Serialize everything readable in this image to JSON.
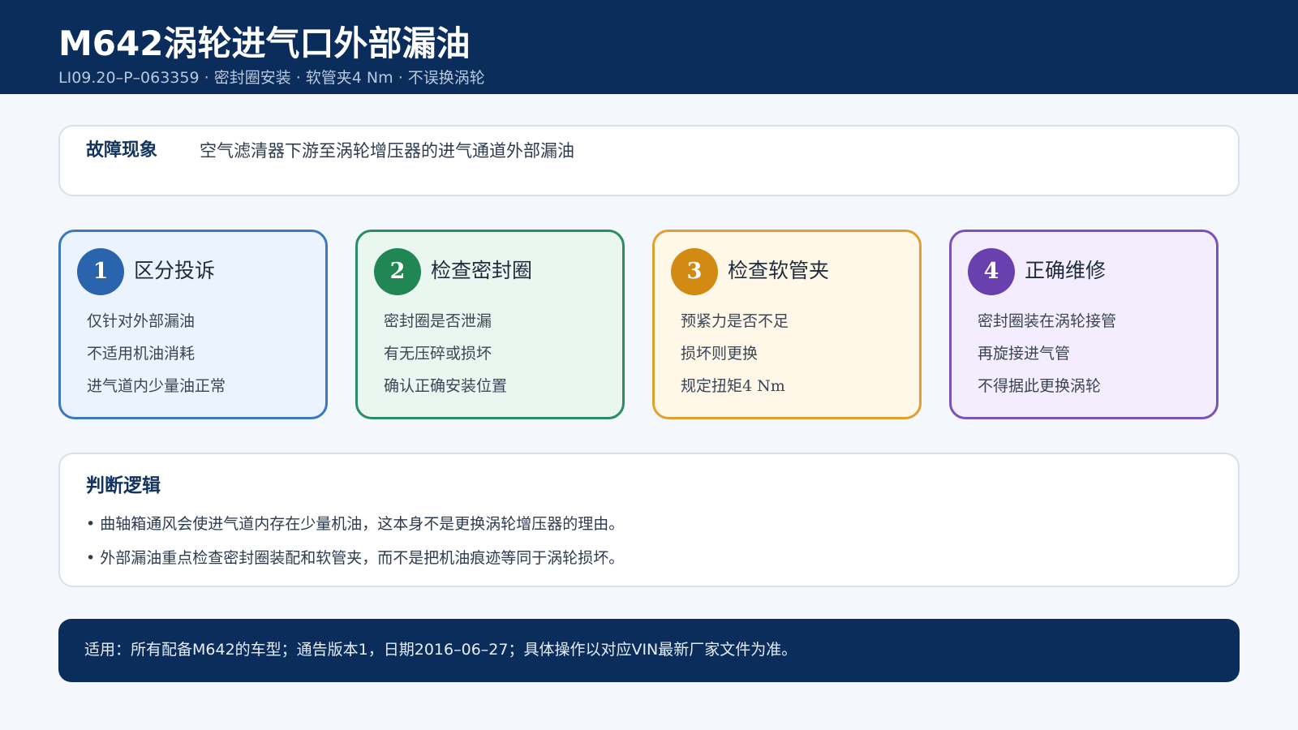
{
  "header": {
    "title": "M642涡轮进气口外部漏油",
    "subtitle": "LI09.20–P–063359 · 密封圈安装 · 软管夹4 Nm · 不误换涡轮"
  },
  "symptom": {
    "label": "故障现象",
    "text": "空气滤清器下游至涡轮增压器的进气通道外部漏油"
  },
  "steps": [
    {
      "number": "1",
      "title": "区分投诉",
      "lines": [
        "仅针对外部漏油",
        "不适用机油消耗",
        "进气道内少量油正常"
      ],
      "color": "#2a64ad"
    },
    {
      "number": "2",
      "title": "检查密封圈",
      "lines": [
        "密封圈是否泄漏",
        "有无压碎或损坏",
        "确认正确安装位置"
      ],
      "color": "#1f8654"
    },
    {
      "number": "3",
      "title": "检查软管夹",
      "lines": [
        "预紧力是否不足",
        "损坏则更换",
        "规定扭矩4 Nm"
      ],
      "color": "#d28a13"
    },
    {
      "number": "4",
      "title": "正确维修",
      "lines": [
        "密封圈装在涡轮接管",
        "再旋接进气管",
        "不得据此更换涡轮"
      ],
      "color": "#6a3fae"
    }
  ],
  "logic": {
    "title": "判断逻辑",
    "bullets": [
      "• 曲轴箱通风会使进气道内存在少量机油，这本身不是更换涡轮增压器的理由。",
      "• 外部漏油重点检查密封圈装配和软管夹，而不是把机油痕迹等同于涡轮损坏。"
    ]
  },
  "footer": {
    "text": "适用：所有配备M642的车型；通告版本1，日期2016–06–27；具体操作以对应VIN最新厂家文件为准。"
  }
}
